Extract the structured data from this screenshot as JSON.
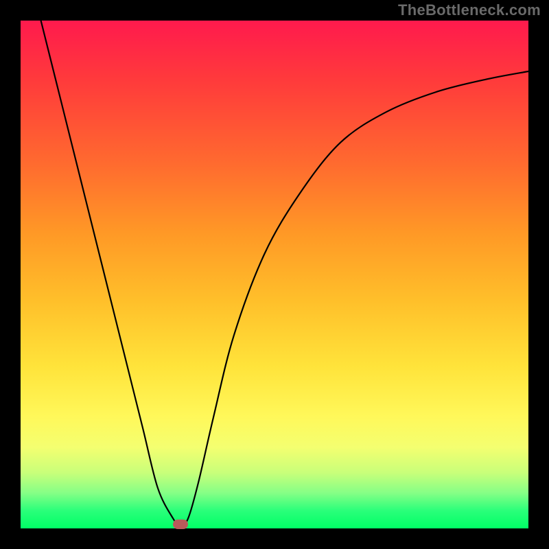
{
  "watermark": "TheBottleneck.com",
  "chart_data": {
    "type": "line",
    "title": "",
    "xlabel": "",
    "ylabel": "",
    "xlim": [
      0,
      100
    ],
    "ylim": [
      0,
      100
    ],
    "series": [
      {
        "name": "curve",
        "x": [
          4,
          8,
          12,
          16,
          20,
          24,
          27,
          30,
          31.5,
          33,
          35,
          38,
          42,
          48,
          55,
          63,
          72,
          82,
          92,
          100
        ],
        "y": [
          100,
          84,
          68,
          52,
          36,
          20,
          8,
          2,
          0.5,
          2,
          9,
          22,
          38,
          54,
          66,
          76,
          82,
          86,
          88.5,
          90
        ]
      }
    ],
    "marker": {
      "x": 31.5,
      "y": 0,
      "color": "#b85a5a"
    },
    "background_gradient": [
      "#ff1a4d",
      "#ffbf2a",
      "#fff85a",
      "#00ff66"
    ]
  }
}
